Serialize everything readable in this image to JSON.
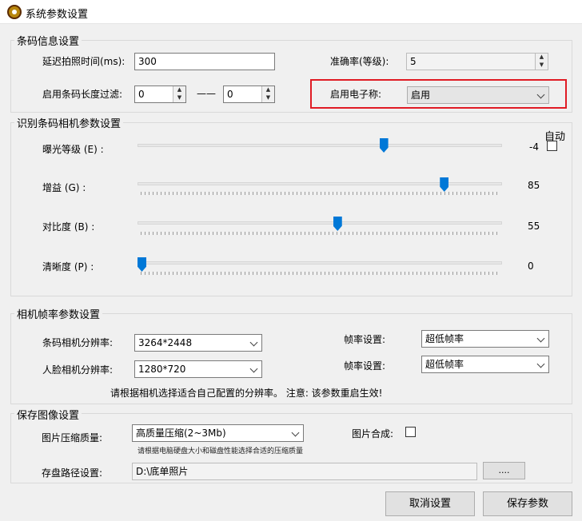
{
  "window": {
    "title": "系统参数设置"
  },
  "barcode_info": {
    "title": "条码信息设置",
    "delay_label": "延迟拍照时间(ms):",
    "delay_value": "300",
    "accuracy_label": "准确率(等级):",
    "accuracy_value": "5",
    "length_filter_label": "启用条码长度过滤:",
    "length_min": "0",
    "length_max": "0",
    "length_separator": "——",
    "scale_label": "启用电子称:",
    "scale_value": "启用"
  },
  "camera_params": {
    "title": "识别条码相机参数设置",
    "auto_label": "自动",
    "auto_checked": false,
    "exposure": {
      "label": "曝光等级 (E) :",
      "value": "-4",
      "level": 0.68
    },
    "gain": {
      "label": "增益 (G) :",
      "value": "85",
      "level": 0.85
    },
    "contrast": {
      "label": "对比度 (B) :",
      "value": "55",
      "level": 0.55
    },
    "sharpness": {
      "label": "清晰度 (P) :",
      "value": "0",
      "level": 0.0
    }
  },
  "framerate": {
    "title": "相机帧率参数设置",
    "barcode_res_label": "条码相机分辨率:",
    "barcode_res_value": "3264*2448",
    "face_res_label": "人脸相机分辨率:",
    "face_res_value": "1280*720",
    "fps_label_1": "帧率设置:",
    "fps_value_1": "超低帧率",
    "fps_label_2": "帧率设置:",
    "fps_value_2": "超低帧率",
    "note": "请根据相机选择适合自己配置的分辨率。  注意: 该参数重启生效!"
  },
  "save_image": {
    "title": "保存图像设置",
    "compress_label": "图片压缩质量:",
    "compress_value": "高质量压缩(2~3Mb)",
    "compress_hint": "请根据电脑硬盘大小和磁盘性能选择合适的压缩质量",
    "merge_label": "图片合成:",
    "merge_checked": false,
    "path_label": "存盘路径设置:",
    "path_value": "D:\\底单照片",
    "browse_label": "...."
  },
  "buttons": {
    "cancel": "取消设置",
    "save": "保存参数"
  }
}
